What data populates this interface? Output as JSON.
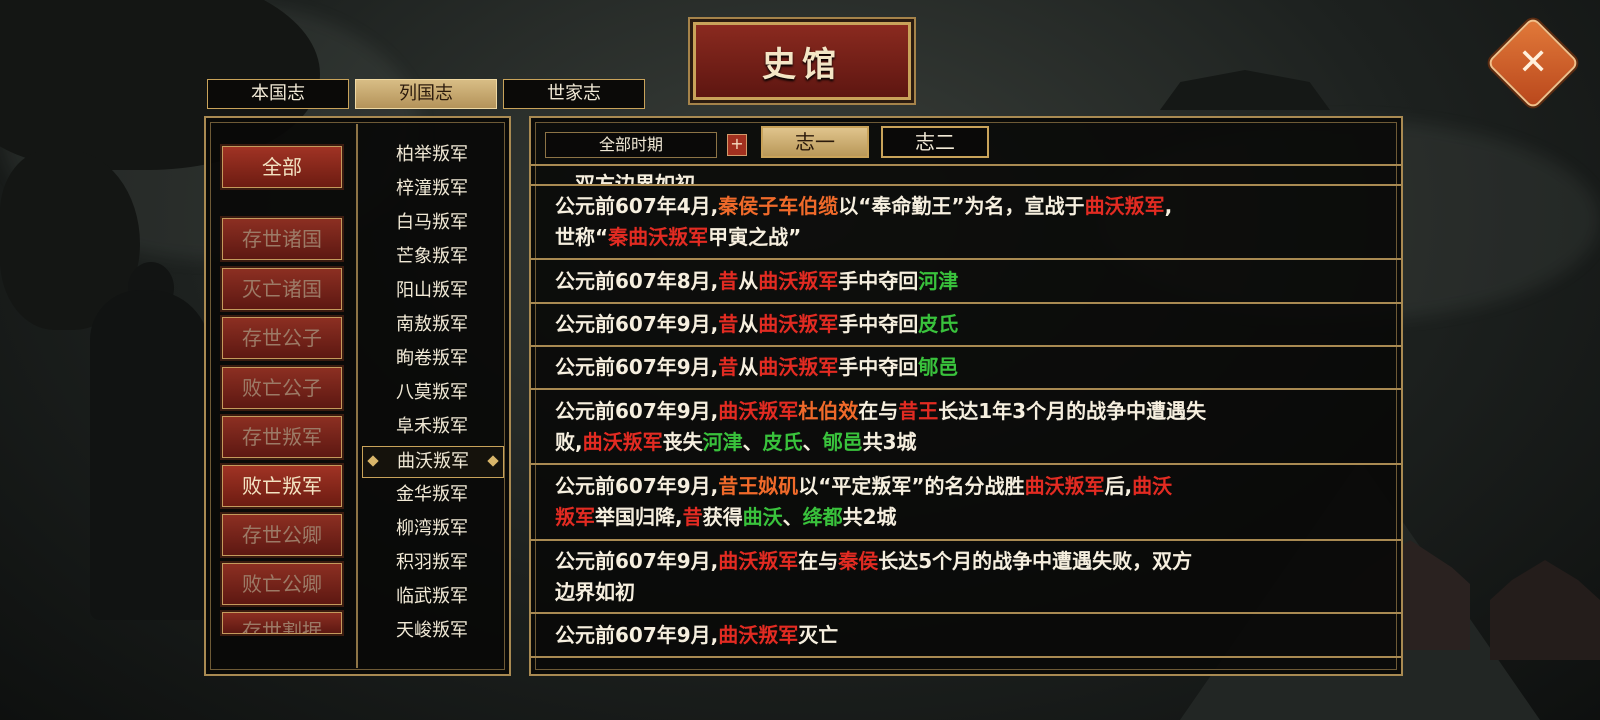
{
  "title": "史馆",
  "close_label": "✕",
  "top_tabs": [
    {
      "label": "本国志",
      "active": false
    },
    {
      "label": "列国志",
      "active": true
    },
    {
      "label": "世家志",
      "active": false
    }
  ],
  "categories": [
    {
      "label": "全部"
    },
    {
      "label": "存世诸国"
    },
    {
      "label": "灭亡诸国"
    },
    {
      "label": "存世公子"
    },
    {
      "label": "败亡公子"
    },
    {
      "label": "存世叛军"
    },
    {
      "label": "败亡叛军"
    },
    {
      "label": "存世公卿"
    },
    {
      "label": "败亡公卿"
    },
    {
      "label": "存世割据"
    }
  ],
  "selected_category": "败亡叛军",
  "rebels": [
    "柏举叛军",
    "梓潼叛军",
    "白马叛军",
    "芒象叛军",
    "阳山叛军",
    "南敖叛军",
    "眴卷叛军",
    "八莫叛军",
    "阜禾叛军",
    "曲沃叛军",
    "金华叛军",
    "柳湾叛军",
    "积羽叛军",
    "临武叛军",
    "天峻叛军"
  ],
  "selected_rebel": "曲沃叛军",
  "period": "全部时期",
  "plus_label": "+",
  "zhi_tabs": [
    {
      "label": "志一",
      "active": true
    },
    {
      "label": "志二",
      "active": false
    }
  ],
  "colors": {
    "red": "#e22b22",
    "orange": "#f06a2a",
    "green": "#39c23c",
    "text": "#f6efdf",
    "gold": "#c9a35a"
  },
  "entries": [
    {
      "lines": [
        [
          {
            "t": "，双方边界如初",
            "c": "white"
          }
        ]
      ]
    },
    {
      "lines": [
        [
          {
            "t": "公元前607年4月,",
            "c": "white"
          },
          {
            "t": "秦侯子车伯缆",
            "c": "orange"
          },
          {
            "t": "以“奉命勤王”为名，宣战于",
            "c": "white"
          },
          {
            "t": "曲沃叛军",
            "c": "red"
          },
          {
            "t": ",",
            "c": "white"
          }
        ],
        [
          {
            "t": "世称“",
            "c": "white"
          },
          {
            "t": "秦曲沃叛军",
            "c": "red"
          },
          {
            "t": "甲寅之战”",
            "c": "white"
          }
        ]
      ]
    },
    {
      "lines": [
        [
          {
            "t": "公元前607年8月,",
            "c": "white"
          },
          {
            "t": "昔",
            "c": "red"
          },
          {
            "t": "从",
            "c": "white"
          },
          {
            "t": "曲沃叛军",
            "c": "red"
          },
          {
            "t": "手中夺回",
            "c": "white"
          },
          {
            "t": "河津",
            "c": "green"
          }
        ]
      ]
    },
    {
      "lines": [
        [
          {
            "t": "公元前607年9月,",
            "c": "white"
          },
          {
            "t": "昔",
            "c": "red"
          },
          {
            "t": "从",
            "c": "white"
          },
          {
            "t": "曲沃叛军",
            "c": "red"
          },
          {
            "t": "手中夺回",
            "c": "white"
          },
          {
            "t": "皮氏",
            "c": "green"
          }
        ]
      ]
    },
    {
      "lines": [
        [
          {
            "t": "公元前607年9月,",
            "c": "white"
          },
          {
            "t": "昔",
            "c": "red"
          },
          {
            "t": "从",
            "c": "white"
          },
          {
            "t": "曲沃叛军",
            "c": "red"
          },
          {
            "t": "手中夺回",
            "c": "white"
          },
          {
            "t": "郇邑",
            "c": "green"
          }
        ]
      ]
    },
    {
      "lines": [
        [
          {
            "t": "公元前607年9月,",
            "c": "white"
          },
          {
            "t": "曲沃叛军",
            "c": "red"
          },
          {
            "t": "杜伯效",
            "c": "orange"
          },
          {
            "t": "在与",
            "c": "white"
          },
          {
            "t": "昔王",
            "c": "red"
          },
          {
            "t": "长达1年3个月的战争中遭遇失",
            "c": "white"
          }
        ],
        [
          {
            "t": "败,",
            "c": "white"
          },
          {
            "t": "曲沃叛军",
            "c": "red"
          },
          {
            "t": "丧失",
            "c": "white"
          },
          {
            "t": "河津",
            "c": "green"
          },
          {
            "t": "、",
            "c": "white"
          },
          {
            "t": "皮氏",
            "c": "green"
          },
          {
            "t": "、",
            "c": "white"
          },
          {
            "t": "郇邑",
            "c": "green"
          },
          {
            "t": "共3城",
            "c": "white"
          }
        ]
      ]
    },
    {
      "lines": [
        [
          {
            "t": "公元前607年9月,",
            "c": "white"
          },
          {
            "t": "昔王姒矶",
            "c": "orange"
          },
          {
            "t": "以“平定叛军”的名分战胜",
            "c": "white"
          },
          {
            "t": "曲沃叛军",
            "c": "red"
          },
          {
            "t": "后,",
            "c": "white"
          },
          {
            "t": "曲沃",
            "c": "red"
          }
        ],
        [
          {
            "t": "叛军",
            "c": "red"
          },
          {
            "t": "举国归降,",
            "c": "white"
          },
          {
            "t": "昔",
            "c": "red"
          },
          {
            "t": "获得",
            "c": "white"
          },
          {
            "t": "曲沃",
            "c": "green"
          },
          {
            "t": "、",
            "c": "white"
          },
          {
            "t": "绛都",
            "c": "green"
          },
          {
            "t": "共2城",
            "c": "white"
          }
        ]
      ]
    },
    {
      "lines": [
        [
          {
            "t": "公元前607年9月,",
            "c": "white"
          },
          {
            "t": "曲沃叛军",
            "c": "red"
          },
          {
            "t": "在与",
            "c": "white"
          },
          {
            "t": "秦侯",
            "c": "red"
          },
          {
            "t": "长达5个月的战争中遭遇失败，双方",
            "c": "white"
          }
        ],
        [
          {
            "t": "边界如初",
            "c": "white"
          }
        ]
      ]
    },
    {
      "lines": [
        [
          {
            "t": "公元前607年9月,",
            "c": "white"
          },
          {
            "t": "曲沃叛军",
            "c": "red"
          },
          {
            "t": "灭亡",
            "c": "white"
          }
        ]
      ]
    }
  ]
}
